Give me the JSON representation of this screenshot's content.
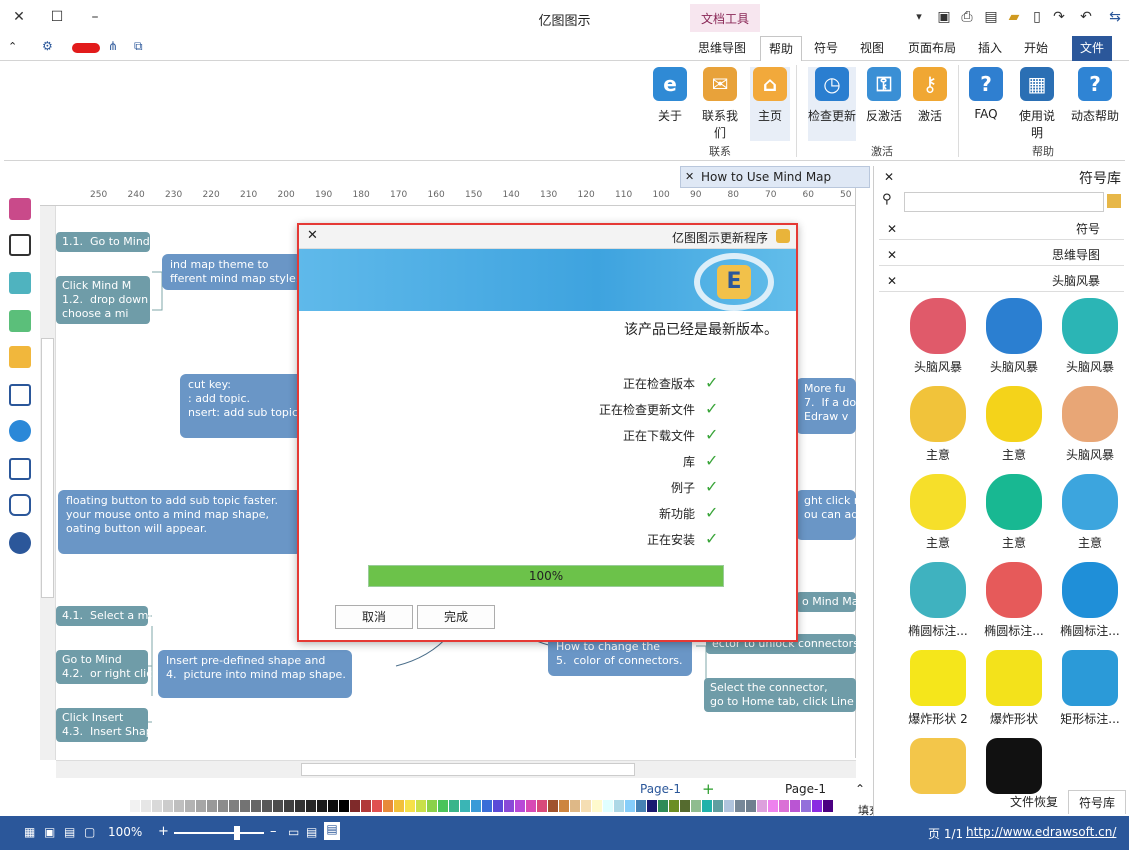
{
  "app": {
    "title": "亿图图示",
    "doc_tools_label": "文档工具"
  },
  "tabs": {
    "file": "文件",
    "start": "开始",
    "insert": "插入",
    "page_layout": "页面布局",
    "view": "视图",
    "symbol": "符号",
    "help": "帮助",
    "mindmap": "思维导图"
  },
  "ribbon": {
    "help_group": {
      "label": "帮助",
      "items": [
        {
          "label": "动态帮助"
        },
        {
          "label": "使用说明"
        },
        {
          "label": "FAQ"
        }
      ]
    },
    "activate_group": {
      "label": "激活",
      "items": [
        {
          "label": "激活"
        },
        {
          "label": "反激活"
        },
        {
          "label": "检查更新"
        }
      ]
    },
    "contact_group": {
      "label": "联系",
      "items": [
        {
          "label": "主页"
        },
        {
          "label": "联系我们"
        },
        {
          "label": "关于"
        }
      ]
    }
  },
  "doc_tab": {
    "label": "How to Use Mind Map"
  },
  "ruler": {
    "ticks": [
      "50",
      "60",
      "70",
      "80",
      "90",
      "100",
      "110",
      "120",
      "130",
      "140",
      "150",
      "160",
      "170",
      "180",
      "190",
      "200",
      "210",
      "220",
      "230",
      "240",
      "250"
    ]
  },
  "canvas": {
    "topics": [
      {
        "text": "1.1.  Go to Mind M"
      },
      {
        "text": "Click Mind M\n1.2.  drop down b\nchoose a mi"
      },
      {
        "text": "ind map theme to\nfferent mind map style."
      },
      {
        "text": "cut key:\n: add topic.\nnsert: add sub topic"
      },
      {
        "text": "More fu\n7.  If a doc\nEdraw v"
      },
      {
        "text": "floating button to add sub topic faster.\nyour mouse onto a mind map shape,\noating button will appear."
      },
      {
        "text": "ght click m\nou can add"
      },
      {
        "text": "4.1.  Select a mi"
      },
      {
        "text": "Go to Mind\n4.2.  or right clic"
      },
      {
        "text": "Click Insert\n4.3.  Insert Shap"
      },
      {
        "text": "Insert pre-defined shape and\n4.  picture into mind map shape."
      },
      {
        "text": "How to change the\n5.  color of connectors."
      },
      {
        "text": "o Mind Ma"
      },
      {
        "text": "ector to unlock connectors"
      },
      {
        "text": "Select the connector,\ngo to Home tab, click Line"
      }
    ]
  },
  "dialog": {
    "title": "亿图图示更新程序",
    "message": "该产品已经是最新版本。",
    "steps": [
      "正在检查版本",
      "正在检查更新文件",
      "正在下载文件",
      "库",
      "例子",
      "新功能",
      "正在安装"
    ],
    "progress_value": 1.0,
    "progress_text": "100%",
    "finish_label": "完成",
    "cancel_label": "取消"
  },
  "right_panel": {
    "title": "符号库",
    "libraries": [
      "符号",
      "思维导图",
      "头脑风暴"
    ],
    "symbols": [
      {
        "label": "头脑风暴",
        "color": "#e05a6a",
        "icon": "brain-icon"
      },
      {
        "label": "头脑风暴",
        "color": "#2b7fd1",
        "icon": "idea-head-icon"
      },
      {
        "label": "头脑风暴",
        "color": "#2bb5b5",
        "icon": "gear-head-icon"
      },
      {
        "label": "主意",
        "color": "#f1c33a",
        "icon": "bulb-icon"
      },
      {
        "label": "主意",
        "color": "#f4d31a",
        "icon": "bulb-dark-icon"
      },
      {
        "label": "头脑风暴",
        "color": "#e8a676",
        "icon": "brain-pink-icon"
      },
      {
        "label": "主意",
        "color": "#f6df2a",
        "icon": "smiley-icon"
      },
      {
        "label": "主意",
        "color": "#18b892",
        "icon": "pacman-icon"
      },
      {
        "label": "主意",
        "color": "#3ca5de",
        "icon": "cloud-icon"
      },
      {
        "label": "椭圆标注...",
        "color": "#3fb2bf",
        "icon": "cloud-callout-icon"
      },
      {
        "label": "椭圆标注...",
        "color": "#e65a5a",
        "icon": "cloud-callout-red-icon"
      },
      {
        "label": "椭圆标注...",
        "color": "#1f8fd8",
        "icon": "oval-callout-icon"
      },
      {
        "label": "爆炸形状 2",
        "color": "#f5e61b",
        "icon": "explosion2-icon"
      },
      {
        "label": "爆炸形状",
        "color": "#f3e21b",
        "icon": "explosion-icon"
      },
      {
        "label": "矩形标注...",
        "color": "#2b9ad8",
        "icon": "rect-callout-icon"
      },
      {
        "label": "",
        "color": "#f3c64a",
        "icon": "starburst-icon"
      },
      {
        "label": "",
        "color": "#111111",
        "icon": "black-burst-icon"
      }
    ],
    "bottom_tabs": [
      "符号库",
      "文件恢复"
    ]
  },
  "pagebar": {
    "page_label": "Page-1",
    "page_select": "Page-1"
  },
  "palette_label": "填充",
  "status": {
    "url": "http://www.edrawsoft.cn/",
    "page": "页 1/1",
    "zoom": "100%"
  }
}
